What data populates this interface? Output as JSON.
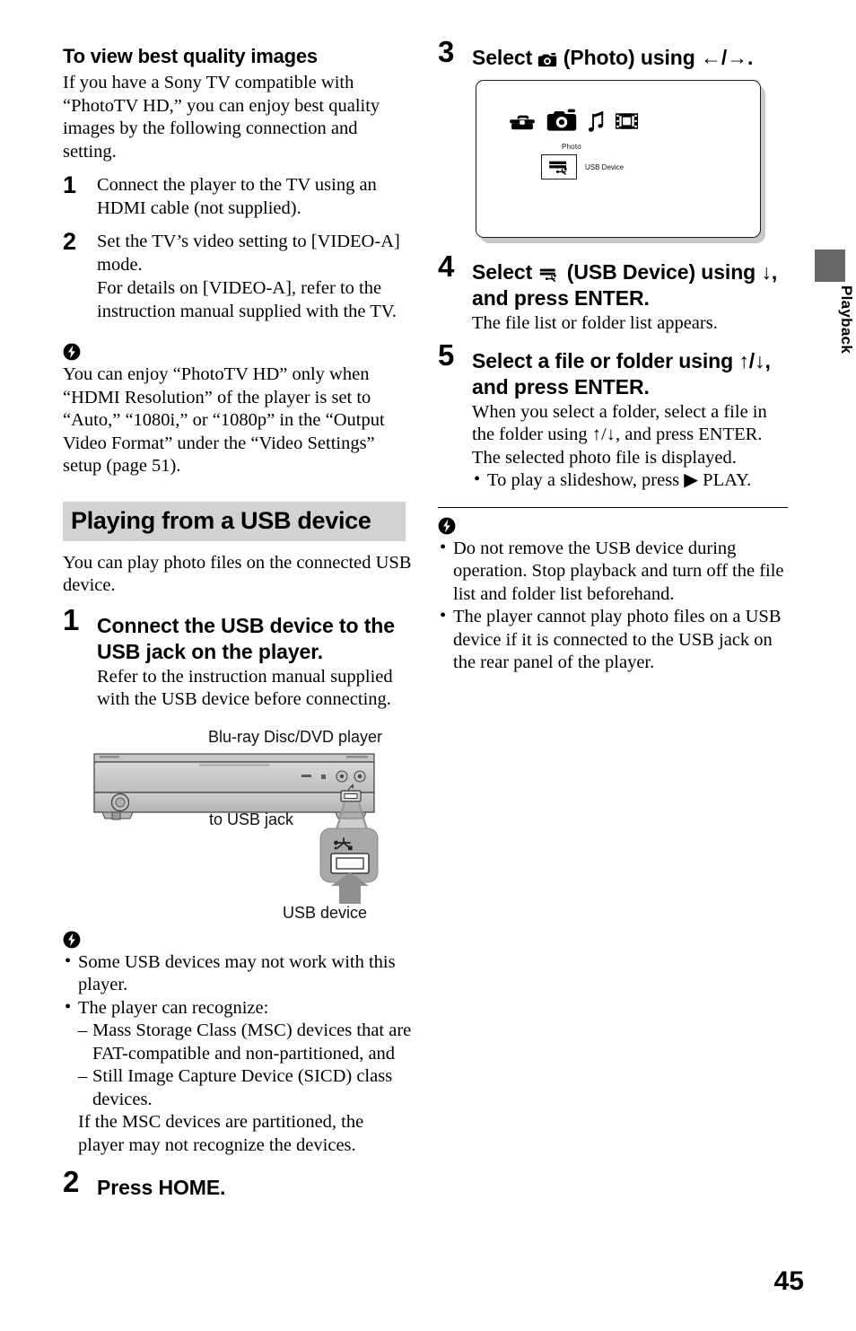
{
  "page": {
    "number": "45",
    "side_tab": "Playback"
  },
  "left_column": {
    "subsection_title": "To view best quality images",
    "intro": "If you have a Sony TV compatible with “PhotoTV HD,” you can enjoy best quality images by the following connection and setting.",
    "steps": [
      {
        "num": "1",
        "head": "Connect the player to the TV using an HDMI cable (not supplied)."
      },
      {
        "num": "2",
        "head": "Set the TV’s video setting to [VIDEO-A] mode.",
        "body": "For details on [VIDEO-A], refer to the instruction manual supplied with the TV."
      }
    ],
    "note_1": {
      "icon": "note-bolt-icon",
      "text": "You can enjoy “PhotoTV HD” only when “HDMI Resolution” of the player is set to “Auto,” “1080i,” or “1080p” in the “Output Video Format” under the “Video Settings” setup (page 51)."
    },
    "section_header": "Playing from a USB device",
    "section_intro": "You can play photo files on the connected USB device.",
    "usb_steps": [
      {
        "num": "1",
        "head": "Connect the USB device to the USB jack on the player.",
        "body": "Refer to the instruction manual supplied with the USB device before connecting."
      },
      {
        "num": "2",
        "head": "Press HOME."
      }
    ],
    "diagram": {
      "caption_player": "Blu-ray Disc/DVD player",
      "caption_jack": "to USB jack",
      "caption_device": "USB device"
    },
    "note_2": {
      "icon": "note-bolt-icon",
      "bullets": [
        {
          "text": "Some USB devices may not work with this player."
        },
        {
          "text": "The player can recognize:",
          "dashes": [
            "Mass Storage Class (MSC) devices that are FAT-compatible and non-partitioned, and",
            "Still Image Capture Device (SICD) class devices."
          ],
          "tail": "If the MSC devices are partitioned, the player may not recognize the devices."
        }
      ]
    }
  },
  "right_column": {
    "steps": [
      {
        "num": "3",
        "head_pre": "Select",
        "head_icon": "photo-camera-icon",
        "head_post": "(Photo) using",
        "head_keys": "←/→.",
        "body": ""
      },
      {
        "num": "4",
        "head_pre": "Select",
        "head_icon": "usb-device-icon",
        "head_post": "(USB Device) using",
        "head_keys": "↓, and press ENTER.",
        "body": "The file list or folder list appears."
      },
      {
        "num": "5",
        "head": "Select a file or folder using ↑/↓, and press ENTER.",
        "body": "When you select a folder, select a file in the folder using ↑/↓, and press ENTER. The selected photo file is displayed.",
        "bullet": "To play a slideshow, press ▶ PLAY."
      }
    ],
    "tv_screen": {
      "icons": [
        "toolbox-icon",
        "photo-camera-icon",
        "music-note-icon",
        "film-strip-icon"
      ],
      "photo_label": "Photo",
      "usb_label": "USB Device"
    },
    "note_3": {
      "icon": "note-bolt-icon",
      "bullets": [
        "Do not remove the USB device during operation. Stop playback and turn off the file list and folder list beforehand.",
        "The player cannot play photo files on a USB device if it is connected to the USB jack on the rear panel of the player."
      ]
    }
  },
  "colors": {
    "band": "#d2d2d2",
    "tab": "#666666",
    "device_gray": "#9a9a9a"
  }
}
